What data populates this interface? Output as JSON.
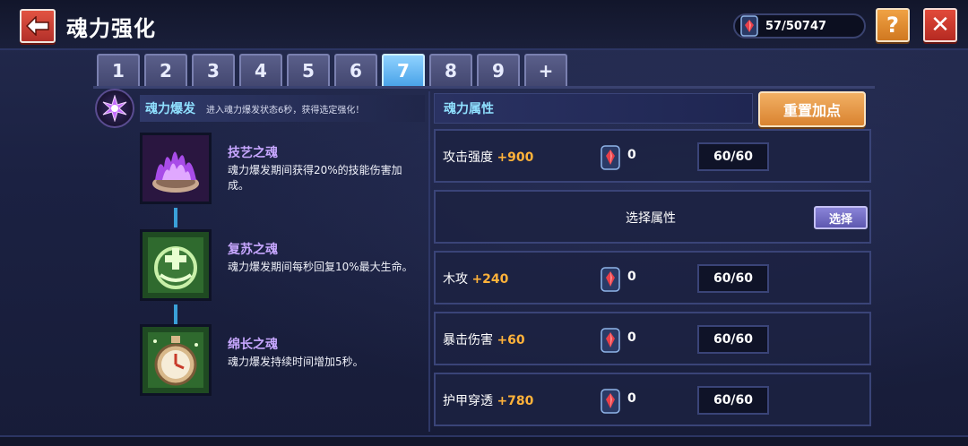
{
  "header": {
    "title": "魂力强化",
    "currency_value": "57/50747"
  },
  "tabs": [
    {
      "label": "1",
      "active": false
    },
    {
      "label": "2",
      "active": false
    },
    {
      "label": "3",
      "active": false
    },
    {
      "label": "4",
      "active": false
    },
    {
      "label": "5",
      "active": false
    },
    {
      "label": "6",
      "active": false
    },
    {
      "label": "7",
      "active": true
    },
    {
      "label": "8",
      "active": false
    },
    {
      "label": "9",
      "active": false
    },
    {
      "label": "+",
      "active": false
    }
  ],
  "burst": {
    "title": "魂力爆发",
    "description": "进入魂力爆发状态6秒，获得选定强化！"
  },
  "skills": [
    {
      "name": "技艺之魂",
      "description": "魂力爆发期间获得20%的技能伤害加成。"
    },
    {
      "name": "复苏之魂",
      "description": "魂力爆发期间每秒回复10%最大生命。"
    },
    {
      "name": "绵长之魂",
      "description": "魂力爆发持续时间增加5秒。"
    }
  ],
  "attributes": {
    "header": "魂力属性",
    "reset_label": "重置加点",
    "select_row": {
      "label": "选择属性",
      "button": "选择"
    },
    "rows": [
      {
        "name": "攻击强度",
        "bonus": "+900",
        "count": "0",
        "progress": "60/60"
      },
      {
        "name": "木攻",
        "bonus": "+240",
        "count": "0",
        "progress": "60/60"
      },
      {
        "name": "暴击伤害",
        "bonus": "+60",
        "count": "0",
        "progress": "60/60"
      },
      {
        "name": "护甲穿透",
        "bonus": "+780",
        "count": "0",
        "progress": "60/60"
      }
    ]
  },
  "colors": {
    "accent_blue": "#4aa3e8",
    "bonus_orange": "#ffb23a",
    "skill_name_purple": "#c7a7ff",
    "close_red": "#b52a22",
    "help_orange": "#d07820"
  },
  "icons": {
    "back": "arrow-left-icon",
    "help": "question-mark-icon",
    "close": "close-icon",
    "currency": "soul-gem-icon",
    "burst": "star-burst-icon"
  }
}
